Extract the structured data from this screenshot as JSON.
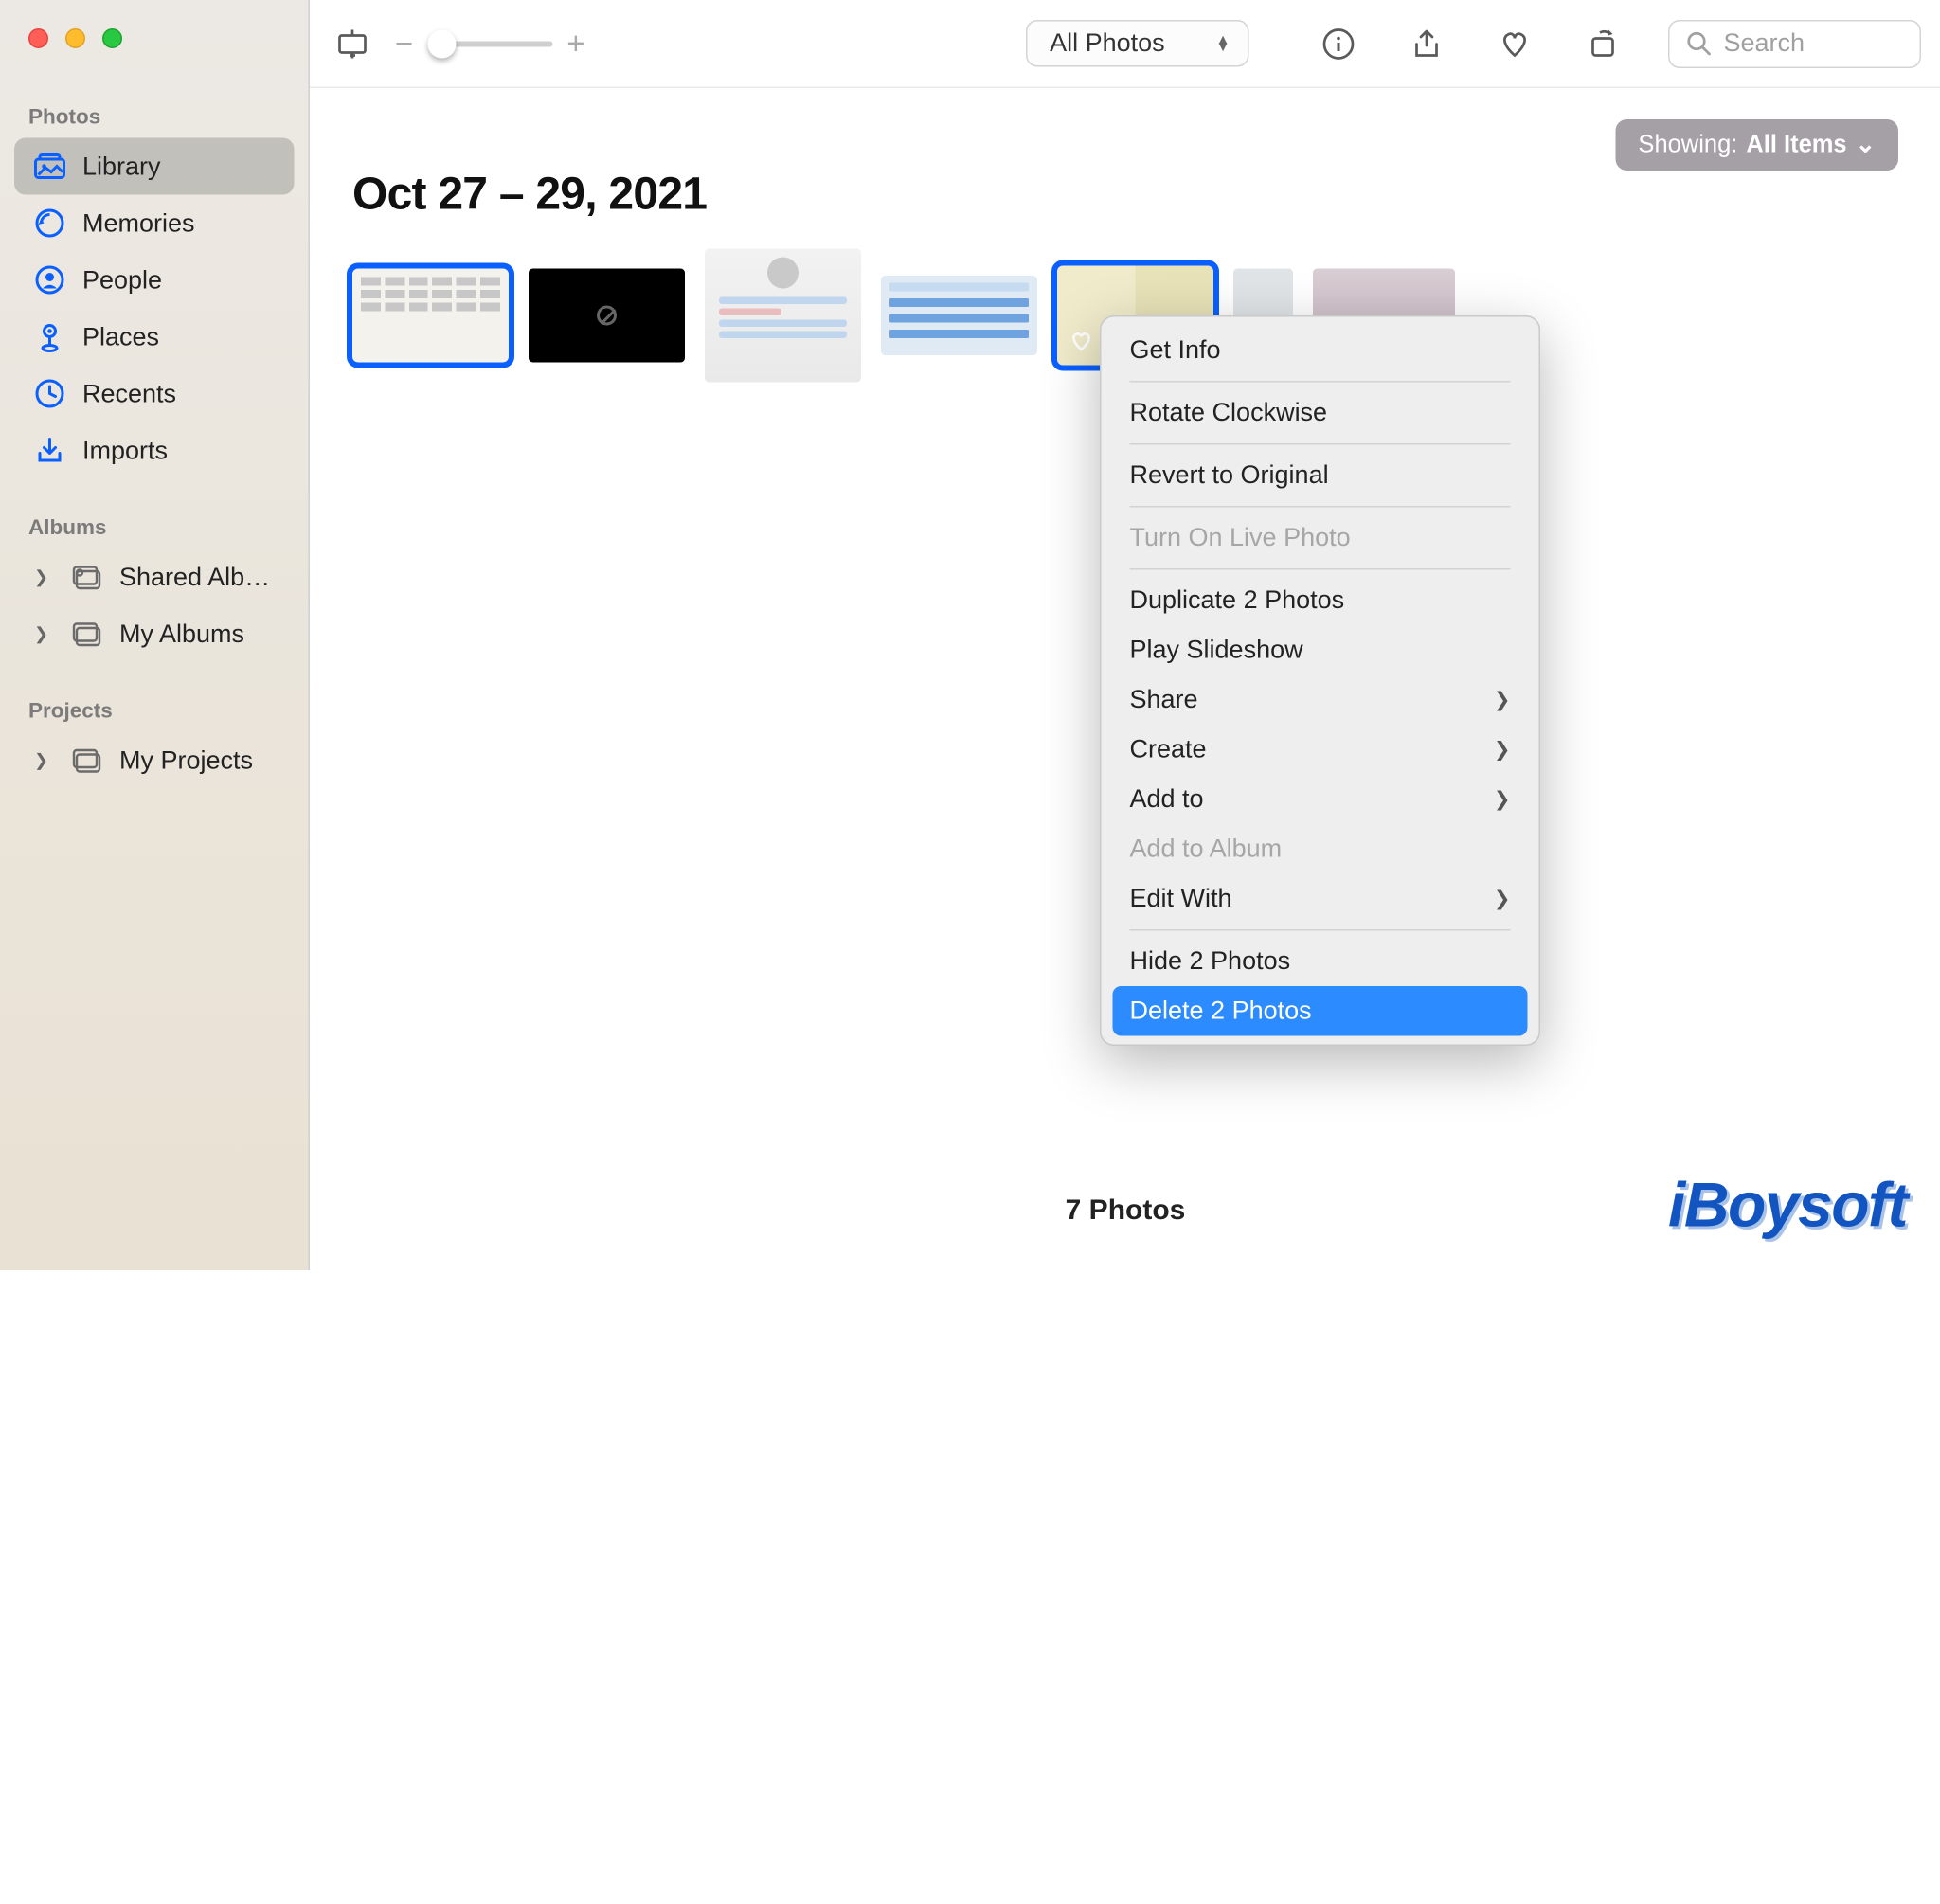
{
  "sidebar": {
    "sections": {
      "photos": {
        "title": "Photos",
        "items": [
          {
            "label": "Library",
            "selected": true
          },
          {
            "label": "Memories"
          },
          {
            "label": "People"
          },
          {
            "label": "Places"
          },
          {
            "label": "Recents"
          },
          {
            "label": "Imports"
          }
        ]
      },
      "albums": {
        "title": "Albums",
        "items": [
          {
            "label": "Shared Alb…",
            "disclosure": true
          },
          {
            "label": "My Albums",
            "disclosure": true
          }
        ]
      },
      "projects": {
        "title": "Projects",
        "items": [
          {
            "label": "My Projects",
            "disclosure": true
          }
        ]
      }
    }
  },
  "toolbar": {
    "view_selector": "All Photos",
    "search_placeholder": "Search"
  },
  "content": {
    "showing_prefix": "Showing: ",
    "showing_value": "All Items",
    "date_title": "Oct 27 – 29, 2021",
    "footer_count": "7 Photos"
  },
  "context_menu": {
    "items": [
      {
        "label": "Get Info"
      },
      {
        "sep": true
      },
      {
        "label": "Rotate Clockwise"
      },
      {
        "sep": true
      },
      {
        "label": "Revert to Original"
      },
      {
        "sep": true
      },
      {
        "label": "Turn On Live Photo",
        "disabled": true
      },
      {
        "sep": true
      },
      {
        "label": "Duplicate 2 Photos"
      },
      {
        "label": "Play Slideshow"
      },
      {
        "label": "Share",
        "submenu": true
      },
      {
        "label": "Create",
        "submenu": true
      },
      {
        "label": "Add to",
        "submenu": true
      },
      {
        "label": "Add to Album",
        "disabled": true
      },
      {
        "label": "Edit With",
        "submenu": true
      },
      {
        "sep": true
      },
      {
        "label": "Hide 2 Photos"
      },
      {
        "label": "Delete 2 Photos",
        "selected": true
      }
    ]
  },
  "watermark": "iBoysoft"
}
